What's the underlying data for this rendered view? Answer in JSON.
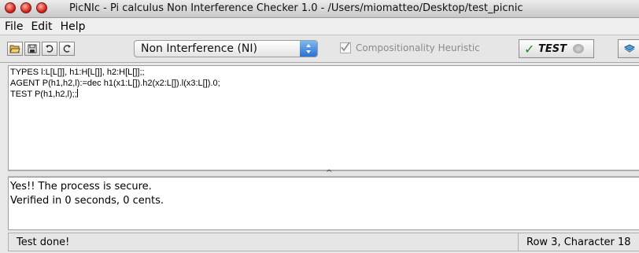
{
  "window": {
    "title": "PicNIc - Pi calculus Non Interference Checker 1.0 - /Users/miomatteo/Desktop/test_picnic",
    "controls": [
      "close",
      "minimize",
      "zoom"
    ]
  },
  "menubar": {
    "items": [
      "File",
      "Edit",
      "Help"
    ]
  },
  "toolbar": {
    "buttons": [
      "open-folder-icon",
      "save-icon",
      "undo-icon",
      "redo-icon"
    ],
    "mode_select": "Non Interference (NI)",
    "heuristic_label": "Compositionality Heuristic",
    "heuristic_checked": true,
    "test_label": "TEST",
    "help_icon": "help-book-icon"
  },
  "editor": {
    "lines": [
      "TYPES l:L[L[]], h1:H[L[]], h2:H[L[]];;",
      "AGENT P(h1,h2,l):=dec h1(x1:L[]).h2(x2:L[]).l(x3:L[]).0;",
      "TEST P(h1,h2,l);;"
    ]
  },
  "output": {
    "lines": [
      "Yes!! The process is secure.",
      "Verified in 0 seconds, 0 cents."
    ]
  },
  "status": {
    "message": "Test done!",
    "position": "Row 3, Character 18"
  },
  "colors": {
    "close": "#d9261c",
    "select_arrow": "#2a6fd3",
    "test_check": "#1a8d1a"
  }
}
